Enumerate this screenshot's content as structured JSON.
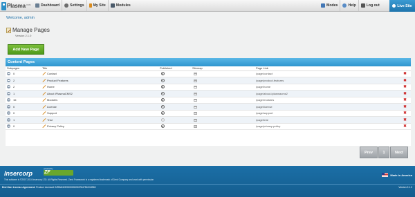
{
  "app": {
    "logo_text": "Plasma",
    "logo_sup": "CMS"
  },
  "nav": {
    "items": [
      {
        "label": "Dashboard",
        "icon": "dashboard-icon",
        "color": "#6a7f93"
      },
      {
        "label": "Settings",
        "icon": "settings-icon",
        "color": "#6d6d6d"
      },
      {
        "label": "My Site",
        "icon": "edit-icon",
        "color": "#d98b1e"
      },
      {
        "label": "Modules",
        "icon": "modules-icon",
        "color": "#4a5a6a"
      }
    ],
    "right_items": [
      {
        "label": "Modes",
        "icon": "modes-icon",
        "color": "#4277b5"
      },
      {
        "label": "Help",
        "icon": "help-icon",
        "color": "#5a8dc7"
      },
      {
        "label": "Log out",
        "icon": "logout-icon",
        "color": "#555555"
      }
    ],
    "live_site_label": "Live Site"
  },
  "welcome": "Welcome, admin",
  "page": {
    "title": "Manage Pages",
    "version": "Version 2.1.0",
    "add_button": "Add New Page"
  },
  "panel": {
    "title": "Content Pages",
    "headers": [
      "Subpages",
      "Title",
      "Published",
      "Sitemap",
      "Page Link"
    ],
    "rows": [
      {
        "subpages": "0",
        "title": "Contact",
        "published": true,
        "link": "/page/contact"
      },
      {
        "subpages": "2",
        "title": "Product Features",
        "published": true,
        "link": "/page/product-features"
      },
      {
        "subpages": "2",
        "title": "Home",
        "published": true,
        "link": "/page/home"
      },
      {
        "subpages": "1",
        "title": "About iPlasmaCMS2",
        "published": true,
        "link": "/page/about-iplasmacms2"
      },
      {
        "subpages": "16",
        "title": "Modules",
        "published": true,
        "link": "/page/modules"
      },
      {
        "subpages": "0",
        "title": "License",
        "published": true,
        "link": "/page/license"
      },
      {
        "subpages": "0",
        "title": "Support",
        "published": true,
        "link": "/page/support"
      },
      {
        "subpages": "1",
        "title": "Trial",
        "published": false,
        "link": "/page/trial"
      },
      {
        "subpages": "0",
        "title": "Privacy Policy",
        "published": true,
        "link": "/page/privacy-policy"
      }
    ]
  },
  "pager": {
    "prev": "Prev",
    "current": "1",
    "next": "Next"
  },
  "footer": {
    "brand": "Insercorp",
    "zf_powered": "powered by",
    "zf_text": "ZF",
    "copyright": "This software is ©2007-2014 Insercorp LTD. All Rights Reserved. Zend Framework is a registered trademark of Zend Company and used with permission",
    "eula_label": "End User License Agreement:",
    "eula_text": "Product License# INR5ANCE0000000003764751D18963",
    "made_in": "Made in America",
    "version": "Version 2.1.0"
  },
  "colors": {
    "accent_blue": "#2e95cf",
    "add_green": "#5ea824",
    "delete_red": "#cc2222",
    "footer_blue": "#1b6fa7"
  }
}
